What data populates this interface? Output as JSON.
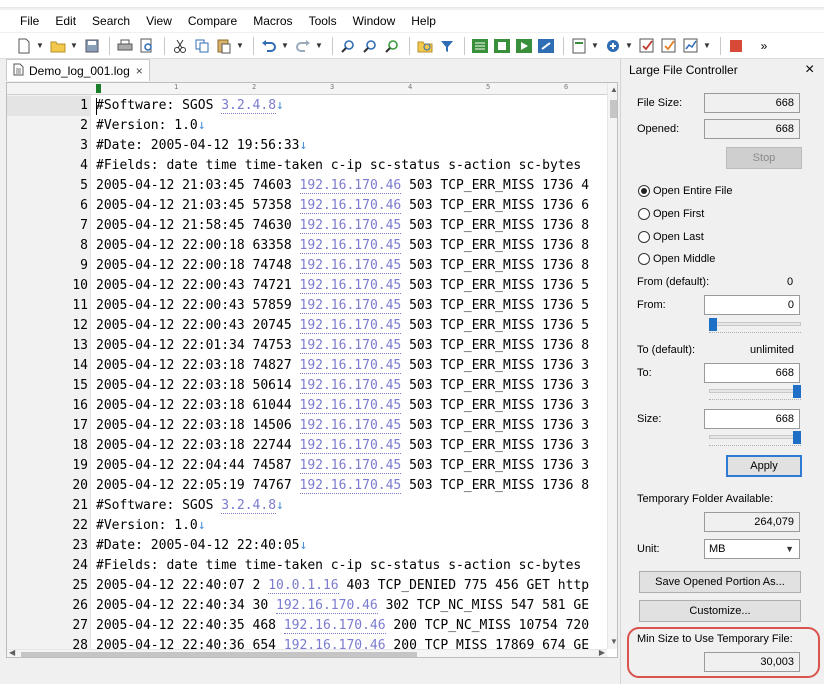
{
  "menu": [
    "File",
    "Edit",
    "Search",
    "View",
    "Compare",
    "Macros",
    "Tools",
    "Window",
    "Help"
  ],
  "toolbar_icons": [
    "new-file-icon",
    "open-file-icon",
    "save-icon",
    "print-icon",
    "print-preview-icon",
    "cut-icon",
    "copy-icon",
    "paste-icon",
    "undo-icon",
    "redo-icon",
    "find-icon",
    "find-next-icon",
    "replace-icon",
    "find-in-files-icon",
    "filter-icon",
    "word-wrap-icon",
    "macro-record-icon",
    "macro-play-icon",
    "tool-icon",
    "properties-icon",
    "customize-icon",
    "check-icon",
    "chart-icon",
    "stop-icon"
  ],
  "tab": {
    "title": "Demo_log_001.log",
    "close": "×"
  },
  "ruler_labels": [
    "1",
    "2",
    "3",
    "4",
    "5",
    "6"
  ],
  "lines": [
    {
      "n": "1",
      "parts": [
        {
          "t": "#Software: SGOS "
        },
        {
          "t": "3.2.4.8",
          "c": "ip"
        },
        {
          "t": "↓",
          "c": "eol"
        }
      ]
    },
    {
      "n": "2",
      "parts": [
        {
          "t": "#Version: 1.0"
        },
        {
          "t": "↓",
          "c": "eol"
        }
      ]
    },
    {
      "n": "3",
      "parts": [
        {
          "t": "#Date: 2005-04-12 19:56:33"
        },
        {
          "t": "↓",
          "c": "eol"
        }
      ]
    },
    {
      "n": "4",
      "parts": [
        {
          "t": "#Fields: date time time-taken c-ip sc-status s-action sc-bytes"
        }
      ]
    },
    {
      "n": "5",
      "parts": [
        {
          "t": "2005-04-12 21:03:45 74603 "
        },
        {
          "t": "192.16.170.46",
          "c": "ip"
        },
        {
          "t": " 503 TCP_ERR_MISS 1736 4"
        }
      ]
    },
    {
      "n": "6",
      "parts": [
        {
          "t": "2005-04-12 21:03:45 57358 "
        },
        {
          "t": "192.16.170.46",
          "c": "ip"
        },
        {
          "t": " 503 TCP_ERR_MISS 1736 6"
        }
      ]
    },
    {
      "n": "7",
      "parts": [
        {
          "t": "2005-04-12 21:58:45 74630 "
        },
        {
          "t": "192.16.170.45",
          "c": "ip"
        },
        {
          "t": " 503 TCP_ERR_MISS 1736 8"
        }
      ]
    },
    {
      "n": "8",
      "parts": [
        {
          "t": "2005-04-12 22:00:18 63358 "
        },
        {
          "t": "192.16.170.45",
          "c": "ip"
        },
        {
          "t": " 503 TCP_ERR_MISS 1736 8"
        }
      ]
    },
    {
      "n": "9",
      "parts": [
        {
          "t": "2005-04-12 22:00:18 74748 "
        },
        {
          "t": "192.16.170.45",
          "c": "ip"
        },
        {
          "t": " 503 TCP_ERR_MISS 1736 8"
        }
      ]
    },
    {
      "n": "10",
      "parts": [
        {
          "t": "2005-04-12 22:00:43 74721 "
        },
        {
          "t": "192.16.170.45",
          "c": "ip"
        },
        {
          "t": " 503 TCP_ERR_MISS 1736 5"
        }
      ]
    },
    {
      "n": "11",
      "parts": [
        {
          "t": "2005-04-12 22:00:43 57859 "
        },
        {
          "t": "192.16.170.45",
          "c": "ip"
        },
        {
          "t": " 503 TCP_ERR_MISS 1736 5"
        }
      ]
    },
    {
      "n": "12",
      "parts": [
        {
          "t": "2005-04-12 22:00:43 20745 "
        },
        {
          "t": "192.16.170.45",
          "c": "ip"
        },
        {
          "t": " 503 TCP_ERR_MISS 1736 5"
        }
      ]
    },
    {
      "n": "13",
      "parts": [
        {
          "t": "2005-04-12 22:01:34 74753 "
        },
        {
          "t": "192.16.170.45",
          "c": "ip"
        },
        {
          "t": " 503 TCP_ERR_MISS 1736 8"
        }
      ]
    },
    {
      "n": "14",
      "parts": [
        {
          "t": "2005-04-12 22:03:18 74827 "
        },
        {
          "t": "192.16.170.45",
          "c": "ip"
        },
        {
          "t": " 503 TCP_ERR_MISS 1736 3"
        }
      ]
    },
    {
      "n": "15",
      "parts": [
        {
          "t": "2005-04-12 22:03:18 50614 "
        },
        {
          "t": "192.16.170.45",
          "c": "ip"
        },
        {
          "t": " 503 TCP_ERR_MISS 1736 3"
        }
      ]
    },
    {
      "n": "16",
      "parts": [
        {
          "t": "2005-04-12 22:03:18 61044 "
        },
        {
          "t": "192.16.170.45",
          "c": "ip"
        },
        {
          "t": " 503 TCP_ERR_MISS 1736 3"
        }
      ]
    },
    {
      "n": "17",
      "parts": [
        {
          "t": "2005-04-12 22:03:18 14506 "
        },
        {
          "t": "192.16.170.45",
          "c": "ip"
        },
        {
          "t": " 503 TCP_ERR_MISS 1736 3"
        }
      ]
    },
    {
      "n": "18",
      "parts": [
        {
          "t": "2005-04-12 22:03:18 22744 "
        },
        {
          "t": "192.16.170.45",
          "c": "ip"
        },
        {
          "t": " 503 TCP_ERR_MISS 1736 3"
        }
      ]
    },
    {
      "n": "19",
      "parts": [
        {
          "t": "2005-04-12 22:04:44 74587 "
        },
        {
          "t": "192.16.170.45",
          "c": "ip"
        },
        {
          "t": " 503 TCP_ERR_MISS 1736 3"
        }
      ]
    },
    {
      "n": "20",
      "parts": [
        {
          "t": "2005-04-12 22:05:19 74767 "
        },
        {
          "t": "192.16.170.45",
          "c": "ip"
        },
        {
          "t": " 503 TCP_ERR_MISS 1736 8"
        }
      ]
    },
    {
      "n": "21",
      "parts": [
        {
          "t": "#Software: SGOS "
        },
        {
          "t": "3.2.4.8",
          "c": "ip"
        },
        {
          "t": "↓",
          "c": "eol"
        }
      ]
    },
    {
      "n": "22",
      "parts": [
        {
          "t": "#Version: 1.0"
        },
        {
          "t": "↓",
          "c": "eol"
        }
      ]
    },
    {
      "n": "23",
      "parts": [
        {
          "t": "#Date: 2005-04-12 22:40:05"
        },
        {
          "t": "↓",
          "c": "eol"
        }
      ]
    },
    {
      "n": "24",
      "parts": [
        {
          "t": "#Fields: date time time-taken c-ip sc-status s-action sc-bytes"
        }
      ]
    },
    {
      "n": "25",
      "parts": [
        {
          "t": "2005-04-12 22:40:07 2 "
        },
        {
          "t": "10.0.1.16",
          "c": "ip"
        },
        {
          "t": " 403 TCP_DENIED 775 456 GET http"
        }
      ]
    },
    {
      "n": "26",
      "parts": [
        {
          "t": "2005-04-12 22:40:34 30 "
        },
        {
          "t": "192.16.170.46",
          "c": "ip"
        },
        {
          "t": " 302 TCP_NC_MISS 547 581 GE"
        }
      ]
    },
    {
      "n": "27",
      "parts": [
        {
          "t": "2005-04-12 22:40:35 468 "
        },
        {
          "t": "192.16.170.46",
          "c": "ip"
        },
        {
          "t": " 200 TCP_NC_MISS 10754 720"
        }
      ]
    },
    {
      "n": "28",
      "parts": [
        {
          "t": "2005-04-12 22:40:36 654 "
        },
        {
          "t": "192.16.170.46",
          "c": "ip"
        },
        {
          "t": " 200 TCP_MISS 17869 674 GE"
        }
      ]
    }
  ],
  "panel": {
    "title": "Large File Controller",
    "close": "×",
    "file_size_label": "File Size:",
    "file_size_value": "668",
    "opened_label": "Opened:",
    "opened_value": "668",
    "stop_label": "Stop",
    "radio_entire": "Open Entire File",
    "radio_first": "Open First",
    "radio_last": "Open Last",
    "radio_middle": "Open Middle",
    "from_default_label": "From (default):",
    "from_default_value": "0",
    "from_label": "From:",
    "from_value": "0",
    "from_level": 0.0,
    "to_default_label": "To (default):",
    "to_default_value": "unlimited",
    "to_label": "To:",
    "to_value": "668",
    "to_level": 1.0,
    "size_label": "Size:",
    "size_value": "668",
    "size_level": 1.0,
    "apply_label": "Apply",
    "temp_available_label": "Temporary Folder Available:",
    "temp_available_value": "264,079",
    "unit_label": "Unit:",
    "unit_value": "MB",
    "save_portion_label": "Save Opened Portion As...",
    "customize_label": "Customize...",
    "min_size_label": "Min Size to Use Temporary File:",
    "min_size_value": "30,003"
  }
}
